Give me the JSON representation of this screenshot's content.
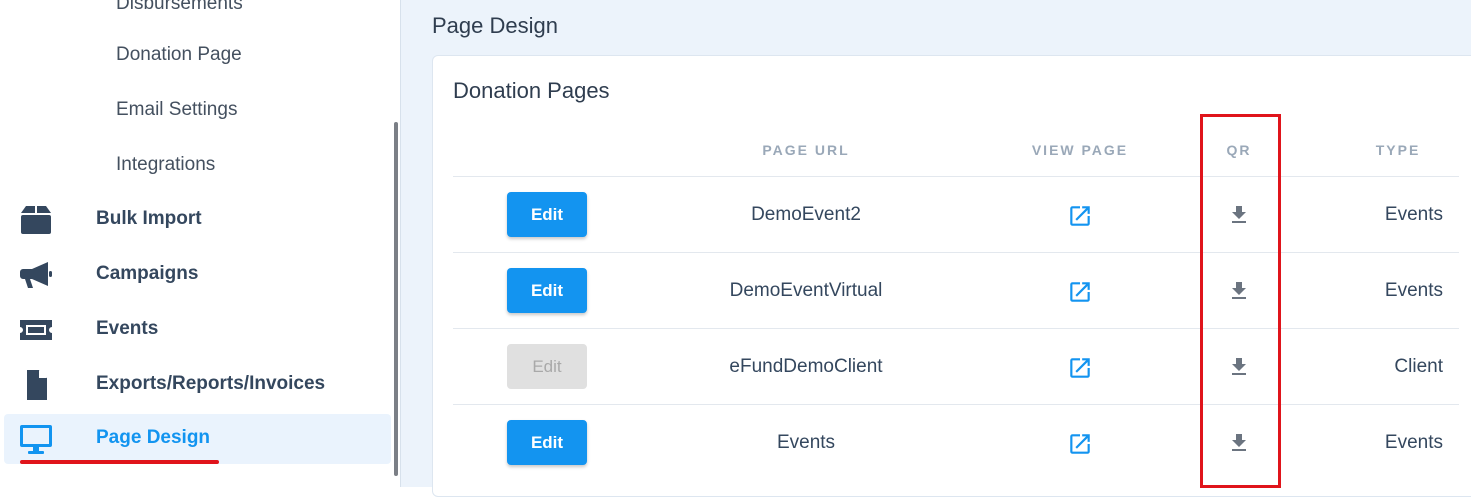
{
  "sidebar": {
    "sub_items": [
      "Disbursements",
      "Donation Page",
      "Email Settings",
      "Integrations"
    ],
    "items": [
      {
        "label": "Bulk Import",
        "icon": "box-icon"
      },
      {
        "label": "Campaigns",
        "icon": "megaphone-icon"
      },
      {
        "label": "Events",
        "icon": "ticket-icon"
      },
      {
        "label": "Exports/Reports/Invoices",
        "icon": "file-icon"
      },
      {
        "label": "Page Design",
        "icon": "monitor-icon",
        "active": true
      }
    ]
  },
  "main": {
    "title": "Page Design",
    "card_title": "Donation Pages",
    "columns": [
      "PAGE URL",
      "VIEW PAGE",
      "QR",
      "TYPE"
    ],
    "rows": [
      {
        "edit_label": "Edit",
        "edit_enabled": true,
        "url": "DemoEvent2",
        "type": "Events"
      },
      {
        "edit_label": "Edit",
        "edit_enabled": true,
        "url": "DemoEventVirtual",
        "type": "Events"
      },
      {
        "edit_label": "Edit",
        "edit_enabled": false,
        "url": "eFundDemoClient",
        "type": "Client"
      },
      {
        "edit_label": "Edit",
        "edit_enabled": true,
        "url": "Events",
        "type": "Events"
      }
    ]
  },
  "colors": {
    "accent": "#1394f0",
    "annotation": "#e0141b",
    "nav_icon": "#34475e"
  }
}
